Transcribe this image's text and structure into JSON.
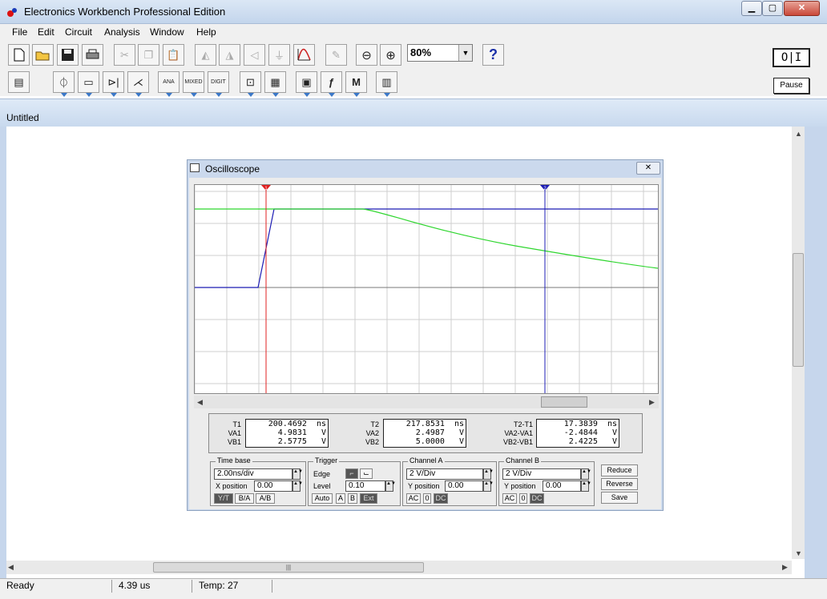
{
  "window": {
    "title": "Electronics Workbench Professional Edition"
  },
  "menu": [
    "File",
    "Edit",
    "Circuit",
    "Analysis",
    "Window",
    "Help"
  ],
  "toolbar": {
    "zoom": "80%",
    "help": "?",
    "power": "O|I",
    "pause": "Pause"
  },
  "document": {
    "title": "Untitled"
  },
  "oscilloscope": {
    "title": "Oscilloscope",
    "colors": {
      "channel_a": "#2fd62f",
      "channel_b": "#1c1cb4",
      "cursor1": "#e02020",
      "cursor2": "#1c1cb4"
    },
    "cursor1_label": "1",
    "cursor2_label": "2",
    "readout": {
      "t1_label": "T1",
      "va1_label": "VA1",
      "vb1_label": "VB1",
      "t1": "200.4692  ns",
      "va1": "4.9831   V",
      "vb1": "2.5775   V",
      "t2_label": "T2",
      "va2_label": "VA2",
      "vb2_label": "VB2",
      "t2": "217.8531  ns",
      "va2": "2.4987   V",
      "vb2": "5.0000   V",
      "dt_label": "T2-T1",
      "dva_label": "VA2-VA1",
      "dvb_label": "VB2-VB1",
      "dt": "17.3839  ns",
      "dva": "-2.4844   V",
      "dvb": "2.4225   V"
    },
    "timebase": {
      "title": "Time base",
      "value": "2.00ns/div",
      "xpos_label": "X position",
      "xpos": "0.00",
      "yt": "Y/T",
      "ba": "B/A",
      "ab": "A/B"
    },
    "trigger": {
      "title": "Trigger",
      "edge_label": "Edge",
      "level_label": "Level",
      "level": "0.10",
      "auto": "Auto",
      "a": "A",
      "b": "B",
      "ext": "Ext"
    },
    "channel_a": {
      "title": "Channel A",
      "value": "2 V/Div",
      "ypos_label": "Y position",
      "ypos": "0.00",
      "ac": "AC",
      "zero": "0",
      "dc": "DC"
    },
    "channel_b": {
      "title": "Channel B",
      "value": "2 V/Div",
      "ypos_label": "Y position",
      "ypos": "0.00",
      "ac": "AC",
      "zero": "0",
      "dc": "DC"
    },
    "buttons": {
      "reduce": "Reduce",
      "reverse": "Reverse",
      "save": "Save"
    }
  },
  "status": {
    "state": "Ready",
    "time": "4.39 us",
    "temp": "Temp: 27"
  }
}
